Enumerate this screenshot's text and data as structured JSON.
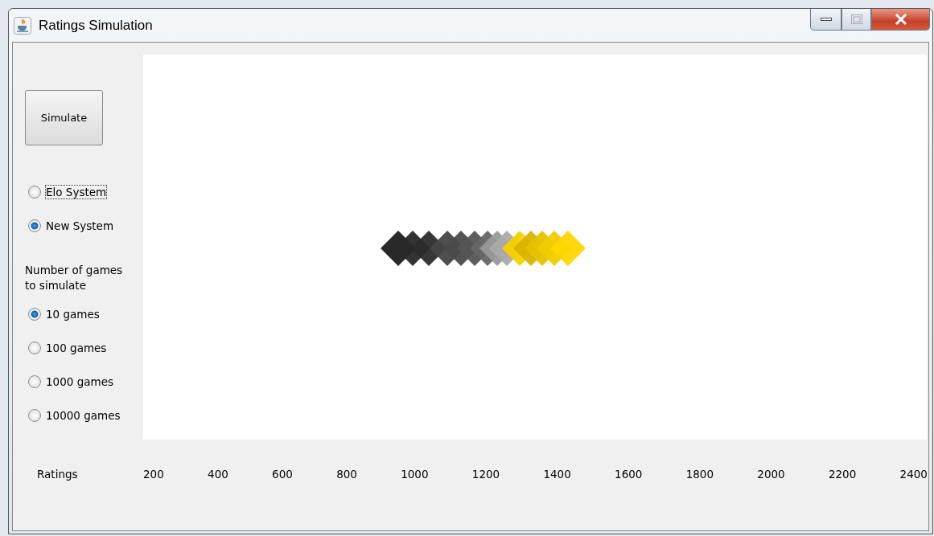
{
  "window": {
    "title": "Ratings Simulation"
  },
  "simulate_button": {
    "label": "Simulate"
  },
  "rating_systems": [
    {
      "label": "Elo System",
      "selected": false,
      "focused": true
    },
    {
      "label": "New System",
      "selected": true,
      "focused": false
    }
  ],
  "games_label": "Number of games to simulate",
  "game_counts": [
    {
      "label": "10 games",
      "selected": true
    },
    {
      "label": "100 games",
      "selected": false
    },
    {
      "label": "1000 games",
      "selected": false
    },
    {
      "label": "10000 games",
      "selected": false
    }
  ],
  "ratings_axis": {
    "label": "Ratings",
    "ticks": [
      "200",
      "400",
      "600",
      "800",
      "1000",
      "1200",
      "1400",
      "1600",
      "1800",
      "2000",
      "2200",
      "2400"
    ]
  }
}
